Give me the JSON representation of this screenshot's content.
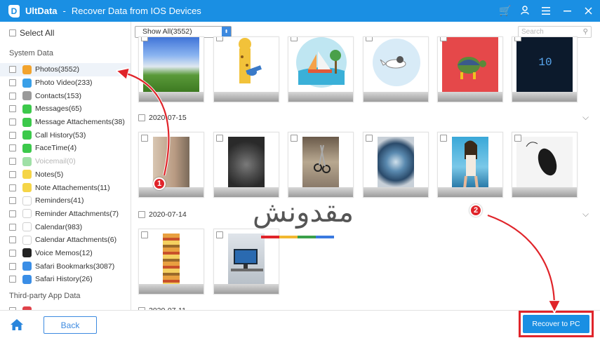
{
  "window": {
    "logo_letter": "D",
    "app_name": "UltData",
    "separator": "-",
    "title": "Recover Data from IOS Devices",
    "icons": [
      "cart-icon",
      "user-icon",
      "menu-icon",
      "minimize-icon",
      "close-icon"
    ]
  },
  "sidebar": {
    "select_all": "Select All",
    "system_title": "System Data",
    "third_party_title": "Third-party App Data",
    "items": [
      {
        "label": "Photos(3552)",
        "icon": "photos-icon",
        "color": "#f2a32d"
      },
      {
        "label": "Photo Video(233)",
        "icon": "photo-video-icon",
        "color": "#3aa0e8"
      },
      {
        "label": "Contacts(153)",
        "icon": "contacts-icon",
        "color": "#9a9a9a"
      },
      {
        "label": "Messages(65)",
        "icon": "messages-icon",
        "color": "#3cc94b"
      },
      {
        "label": "Message Attachements(38)",
        "icon": "message-attachments-icon",
        "color": "#3cc94b"
      },
      {
        "label": "Call History(53)",
        "icon": "call-history-icon",
        "color": "#3cc94b"
      },
      {
        "label": "FaceTime(4)",
        "icon": "facetime-icon",
        "color": "#3cc94b"
      },
      {
        "label": "Voicemail(0)",
        "icon": "voicemail-icon",
        "color": "#9fe0a6"
      },
      {
        "label": "Notes(5)",
        "icon": "notes-icon",
        "color": "#f5d547"
      },
      {
        "label": "Note Attachements(11)",
        "icon": "note-attachments-icon",
        "color": "#f5d547"
      },
      {
        "label": "Reminders(41)",
        "icon": "reminders-icon",
        "color": "#ffffff"
      },
      {
        "label": "Reminder Attachments(7)",
        "icon": "reminder-attachments-icon",
        "color": "#ffffff"
      },
      {
        "label": "Calendar(983)",
        "icon": "calendar-icon",
        "color": "#ffffff"
      },
      {
        "label": "Calendar Attachments(6)",
        "icon": "calendar-attachments-icon",
        "color": "#ffffff"
      },
      {
        "label": "Voice Memos(12)",
        "icon": "voice-memos-icon",
        "color": "#222222"
      },
      {
        "label": "Safari Bookmarks(3087)",
        "icon": "safari-bookmarks-icon",
        "color": "#3a8ee6"
      },
      {
        "label": "Safari History(26)",
        "icon": "safari-history-icon",
        "color": "#3a8ee6"
      }
    ]
  },
  "toolbar": {
    "show_select": "Show All(3552)",
    "search_placeholder": "Search"
  },
  "groups": [
    {
      "date": "2020-07-15"
    },
    {
      "date": "2020-07-14"
    },
    {
      "date": "2020-07-11"
    }
  ],
  "annotations": {
    "badge1": "1",
    "badge2": "2",
    "watermark": "مقدونش"
  },
  "bottom": {
    "back": "Back",
    "recover": "Recover to PC"
  },
  "colors": {
    "accent": "#1a8fe3",
    "highlight": "#e0242a"
  }
}
